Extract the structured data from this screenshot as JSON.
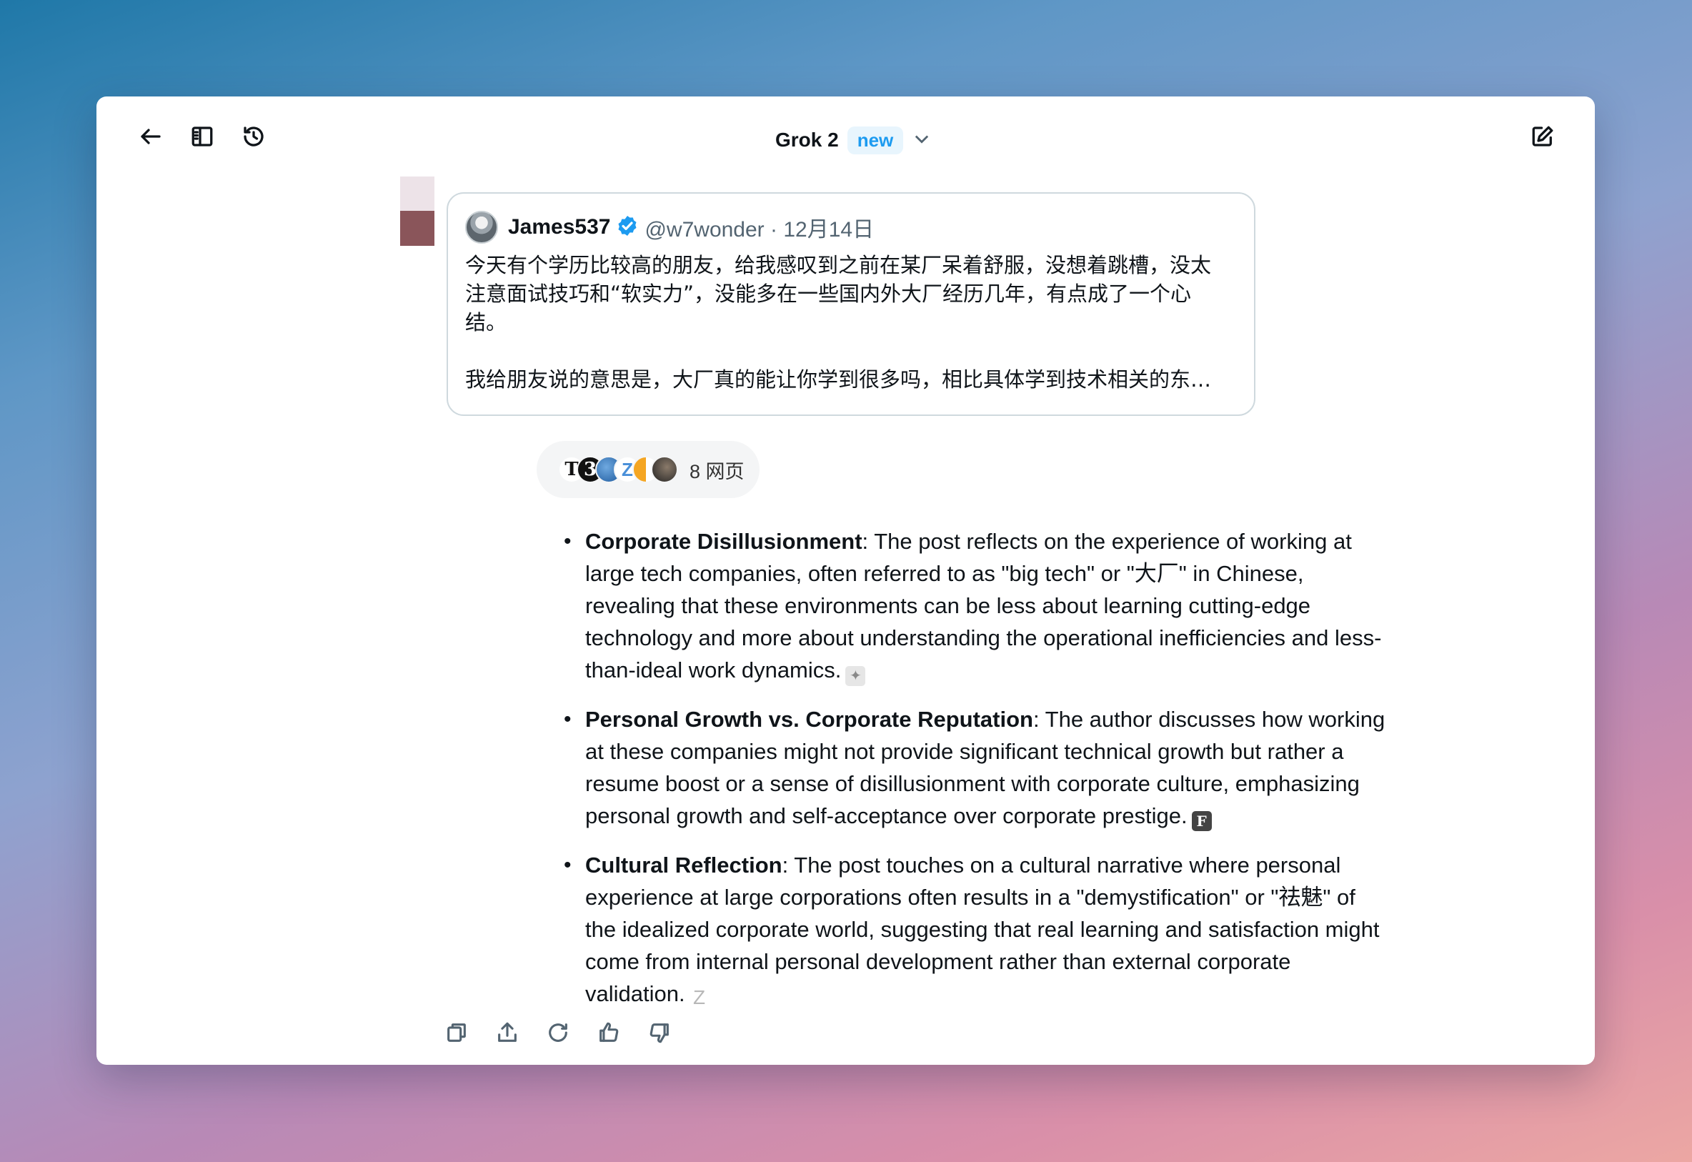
{
  "header": {
    "model_name": "Grok 2",
    "model_badge": "new",
    "icons": [
      "back-arrow-icon",
      "sidebar-icon",
      "history-icon",
      "chevron-down-icon",
      "new-chat-icon"
    ]
  },
  "quoted_post": {
    "author_name": "James537",
    "handle_date": "@w7wonder · 12月14日",
    "paragraph1": "今天有个学历比较高的朋友，给我感叹到之前在某厂呆着舒服，没想着跳槽，没太\n注意面试技巧和“软实力”，没能多在一些国内外大厂经历几年，有点成了一个心\n结。",
    "paragraph2": "我给朋友说的意思是，大厂真的能让你学到很多吗，相比具体学到技术相关的东…"
  },
  "sources": {
    "count_label": "8 网页",
    "favicons": [
      "T",
      "3",
      "",
      "Z",
      "",
      ""
    ]
  },
  "answer": {
    "items": [
      {
        "title": "Corporate Disillusionment",
        "text": ": The post reflects on the experience of working at large tech companies, often referred to as \"big tech\" or \"大厂\" in Chinese, revealing that these environments can be less about learning cutting-edge technology and more about understanding the operational inefficiencies and less-than-ideal work dynamics.",
        "cite": "✦"
      },
      {
        "title": "Personal Growth vs. Corporate Reputation",
        "text": ": The author discusses how working at these companies might not provide significant technical growth but rather a resume boost or a sense of disillusionment with corporate culture, emphasizing personal growth and self-acceptance over corporate prestige.",
        "cite": "F"
      },
      {
        "title": "Cultural Reflection",
        "text": ": The post touches on a cultural narrative where personal experience at large corporations often results in a \"demystification\" or \"祛魅\" of the idealized corporate world, suggesting that real learning and satisfaction might come from internal personal development rather than external corporate validation.",
        "cite": "Z"
      }
    ]
  },
  "actions": [
    "copy-icon",
    "share-icon",
    "regenerate-icon",
    "thumbs-up-icon",
    "thumbs-down-icon"
  ]
}
